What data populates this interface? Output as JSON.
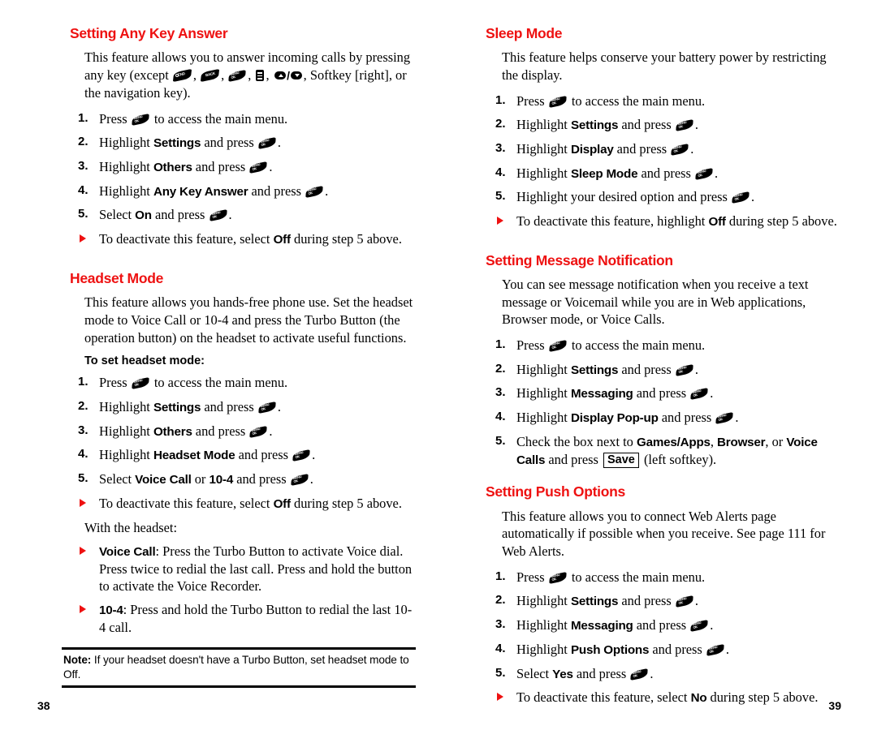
{
  "document": {
    "kind": "phone-user-guide-spread",
    "heading_color": "#ee1111",
    "text_color": "#000000",
    "background": "#ffffff"
  },
  "left_page": {
    "folio": "38",
    "sections": [
      {
        "id": "any-key-answer",
        "title": "Setting Any Key Answer",
        "intro_parts": {
          "a": "This feature allows you to answer incoming calls by pressing any key (except ",
          "b": ", ",
          "c": ", ",
          "d": ", ",
          "e": ", ",
          "f": ", Softkey [right], or the navigation key)."
        },
        "icons": [
          "end-key-icon",
          "back-key-icon",
          "menu-ok-key-icon",
          "list-key-icon",
          "volume-nav-key-icon"
        ],
        "steps": [
          {
            "num": "1.",
            "pre": "Press ",
            "icon": "menu-ok-key-icon",
            "post": " to access the main menu.",
            "bold": ""
          },
          {
            "num": "2.",
            "pre": "Highlight ",
            "bold": "Settings",
            "mid": " and press ",
            "icon": "menu-ok-key-icon",
            "post": "."
          },
          {
            "num": "3.",
            "pre": "Highlight ",
            "bold": "Others",
            "mid": " and press ",
            "icon": "menu-ok-key-icon",
            "post": "."
          },
          {
            "num": "4.",
            "pre": "Highlight ",
            "bold": "Any Key Answer",
            "mid": " and press ",
            "icon": "menu-ok-key-icon",
            "post": "."
          },
          {
            "num": "5.",
            "pre": "Select ",
            "bold": "On",
            "mid": " and press ",
            "icon": "menu-ok-key-icon",
            "post": "."
          }
        ],
        "bullets": [
          {
            "pre": "To deactivate this feature, select ",
            "bold": "Off",
            "post": " during step 5 above."
          }
        ]
      },
      {
        "id": "headset-mode",
        "title": "Headset Mode",
        "intro": "This feature allows you hands-free phone use. Set the headset mode to Voice Call or 10-4 and press the Turbo Button (the operation button) on the headset to activate useful functions.",
        "subhead": "To set headset mode:",
        "steps": [
          {
            "num": "1.",
            "pre": "Press ",
            "icon": "menu-ok-key-icon",
            "post": " to access the main menu.",
            "bold": ""
          },
          {
            "num": "2.",
            "pre": "Highlight ",
            "bold": "Settings",
            "mid": " and press ",
            "icon": "menu-ok-key-icon",
            "post": "."
          },
          {
            "num": "3.",
            "pre": "Highlight ",
            "bold": "Others",
            "mid": " and press ",
            "icon": "menu-ok-key-icon",
            "post": "."
          },
          {
            "num": "4.",
            "pre": "Highlight ",
            "bold": "Headset Mode",
            "mid": " and press ",
            "icon": "menu-ok-key-icon",
            "post": "."
          },
          {
            "num": "5.",
            "pre": "Select ",
            "bold": "Voice Call",
            "mid": " or ",
            "bold2": "10-4",
            "mid2": " and press ",
            "icon": "menu-ok-key-icon",
            "post": "."
          }
        ],
        "bullets": [
          {
            "pre": "To deactivate this feature, select ",
            "bold": "Off",
            "post": " during step 5 above."
          }
        ],
        "with_headset_label": "With the headset:",
        "headset_bullets": [
          {
            "bold": "Voice Call",
            "text": ": Press the Turbo Button to activate Voice dial. Press twice to redial the last call. Press and hold the button to activate the Voice Recorder."
          },
          {
            "bold": "10-4",
            "text": ": Press and hold the Turbo Button to redial the last 10-4 call."
          }
        ],
        "note": {
          "label": "Note:",
          "text": " If your headset doesn't have a Turbo Button, set headset mode to Off."
        }
      }
    ]
  },
  "right_page": {
    "folio": "39",
    "sections": [
      {
        "id": "sleep-mode",
        "title": "Sleep Mode",
        "intro": "This feature helps conserve your battery power by restricting the display.",
        "steps": [
          {
            "num": "1.",
            "pre": "Press ",
            "icon": "menu-ok-key-icon",
            "post": " to access the main menu.",
            "bold": ""
          },
          {
            "num": "2.",
            "pre": "Highlight ",
            "bold": "Settings",
            "mid": " and press ",
            "icon": "menu-ok-key-icon",
            "post": "."
          },
          {
            "num": "3.",
            "pre": "Highlight ",
            "bold": "Display",
            "mid": " and press ",
            "icon": "menu-ok-key-icon",
            "post": "."
          },
          {
            "num": "4.",
            "pre": "Highlight ",
            "bold": "Sleep Mode",
            "mid": " and press ",
            "icon": "menu-ok-key-icon",
            "post": "."
          },
          {
            "num": "5.",
            "pre": "Highlight your desired option and press ",
            "bold": "",
            "mid": "",
            "icon": "menu-ok-key-icon",
            "post": "."
          }
        ],
        "bullets": [
          {
            "pre": "To deactivate this feature, highlight ",
            "bold": "Off",
            "post": " during step 5 above."
          }
        ]
      },
      {
        "id": "message-notification",
        "title": "Setting Message Notification",
        "intro": "You can see message notification when you receive a text message or Voicemail while you are in Web applications, Browser mode, or Voice Calls.",
        "steps": [
          {
            "num": "1.",
            "pre": "Press ",
            "icon": "menu-ok-key-icon",
            "post": " to access the main menu.",
            "bold": ""
          },
          {
            "num": "2.",
            "pre": "Highlight ",
            "bold": "Settings",
            "mid": " and press ",
            "icon": "menu-ok-key-icon",
            "post": "."
          },
          {
            "num": "3.",
            "pre": "Highlight ",
            "bold": "Messaging",
            "mid": " and press ",
            "icon": "menu-ok-key-icon",
            "post": "."
          },
          {
            "num": "4.",
            "pre": "Highlight ",
            "bold": "Display Pop-up",
            "mid": " and press ",
            "icon": "menu-ok-key-icon",
            "post": "."
          }
        ],
        "step5": {
          "num": "5.",
          "a": "Check the box next to ",
          "b1": "Games/Apps",
          "c1": ", ",
          "b2": "Browser",
          "c2": ", or ",
          "b3": "Voice Calls",
          "d": " and press ",
          "softkey": "Save",
          "e": " (left softkey)."
        }
      },
      {
        "id": "push-options",
        "title": "Setting Push Options",
        "intro": "This feature allows you to connect Web Alerts page automatically if possible when you receive. See page 111 for Web Alerts.",
        "steps": [
          {
            "num": "1.",
            "pre": "Press ",
            "icon": "menu-ok-key-icon",
            "post": " to access the main menu.",
            "bold": ""
          },
          {
            "num": "2.",
            "pre": "Highlight ",
            "bold": "Settings",
            "mid": " and press ",
            "icon": "menu-ok-key-icon",
            "post": "."
          },
          {
            "num": "3.",
            "pre": "Highlight ",
            "bold": "Messaging",
            "mid": " and press ",
            "icon": "menu-ok-key-icon",
            "post": "."
          },
          {
            "num": "4.",
            "pre": "Highlight ",
            "bold": "Push Options",
            "mid": " and press ",
            "icon": "menu-ok-key-icon",
            "post": "."
          },
          {
            "num": "5.",
            "pre": "Select ",
            "bold": "Yes",
            "mid": " and press ",
            "icon": "menu-ok-key-icon",
            "post": "."
          }
        ],
        "bullets": [
          {
            "pre": "To deactivate this feature, select ",
            "bold": "No",
            "post": " during step 5 above."
          }
        ]
      }
    ]
  },
  "key_icons": {
    "end": "END",
    "back": "BACK",
    "menu": "MENU OK",
    "list": "list-lines",
    "nav": "up-down"
  }
}
